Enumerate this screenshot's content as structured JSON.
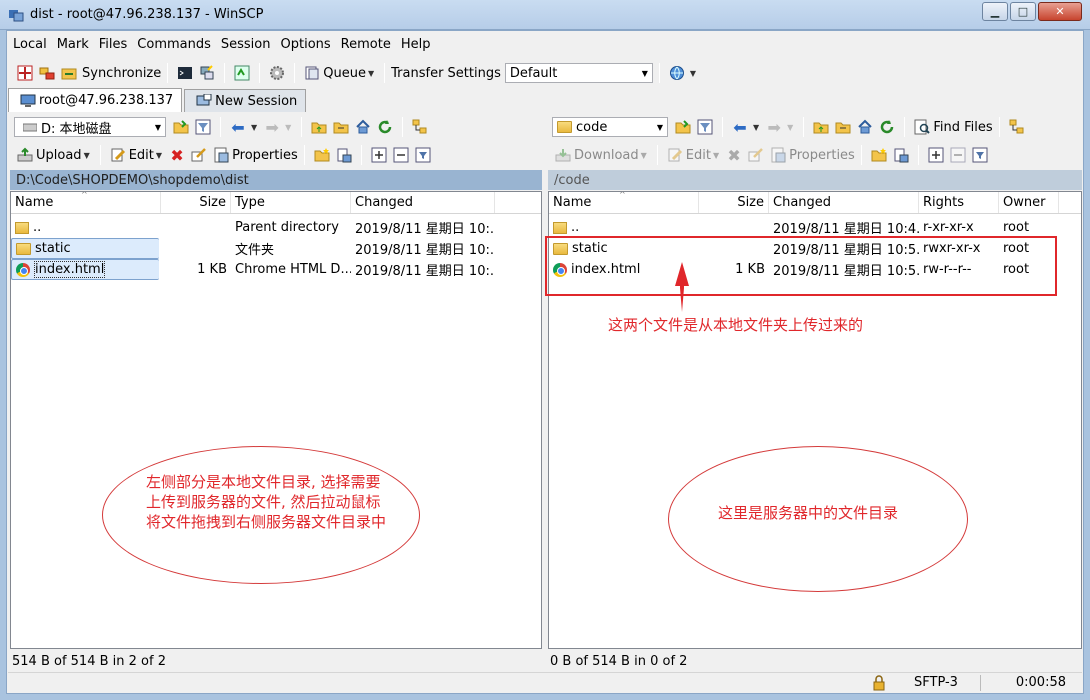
{
  "window": {
    "title": "dist - root@47.96.238.137 - WinSCP",
    "minimize": "▁",
    "maximize": "□",
    "close": "✕"
  },
  "menu": [
    "Local",
    "Mark",
    "Files",
    "Commands",
    "Session",
    "Options",
    "Remote",
    "Help"
  ],
  "toolbar": {
    "synchronize": "Synchronize",
    "queue": "Queue",
    "transfer_settings_label": "Transfer Settings",
    "transfer_settings_value": "Default"
  },
  "tabs": {
    "session": "root@47.96.238.137",
    "new_session": "New Session"
  },
  "left": {
    "drive": "D: 本地磁盘",
    "upload": "Upload",
    "edit": "Edit",
    "properties": "Properties",
    "path": "D:\\Code\\SHOPDEMO\\shopdemo\\dist",
    "columns": {
      "name": "Name",
      "size": "Size",
      "type": "Type",
      "changed": "Changed"
    },
    "rows": [
      {
        "name": "..",
        "size": "",
        "type": "Parent directory",
        "changed": "2019/8/11 星期日 10:..."
      },
      {
        "name": "static",
        "size": "",
        "type": "文件夹",
        "changed": "2019/8/11 星期日 10:..."
      },
      {
        "name": "index.html",
        "size": "1 KB",
        "type": "Chrome HTML D...",
        "changed": "2019/8/11 星期日 10:..."
      }
    ],
    "status": "514 B of 514 B in 2 of 2"
  },
  "right": {
    "folder": "code",
    "find_files": "Find Files",
    "download": "Download",
    "edit": "Edit",
    "properties": "Properties",
    "path": "/code",
    "columns": {
      "name": "Name",
      "size": "Size",
      "changed": "Changed",
      "rights": "Rights",
      "owner": "Owner"
    },
    "rows": [
      {
        "name": "..",
        "size": "",
        "changed": "2019/8/11 星期日 10:4...",
        "rights": "r-xr-xr-x",
        "owner": "root"
      },
      {
        "name": "static",
        "size": "",
        "changed": "2019/8/11 星期日 10:5...",
        "rights": "rwxr-xr-x",
        "owner": "root"
      },
      {
        "name": "index.html",
        "size": "1 KB",
        "changed": "2019/8/11 星期日 10:5...",
        "rights": "rw-r--r--",
        "owner": "root"
      }
    ],
    "status": "0 B of 514 B in 0 of 2"
  },
  "statusbar": {
    "protocol": "SFTP-3",
    "time": "0:00:58"
  },
  "annotations": {
    "uploaded_note": "这两个文件是从本地文件夹上传过来的",
    "left_note_lines": [
      "左侧部分是本地文件目录, 选择需要",
      "上传到服务器的文件, 然后拉动鼠标",
      "将文件拖拽到右侧服务器文件目录中"
    ],
    "right_note": "这里是服务器中的文件目录"
  }
}
